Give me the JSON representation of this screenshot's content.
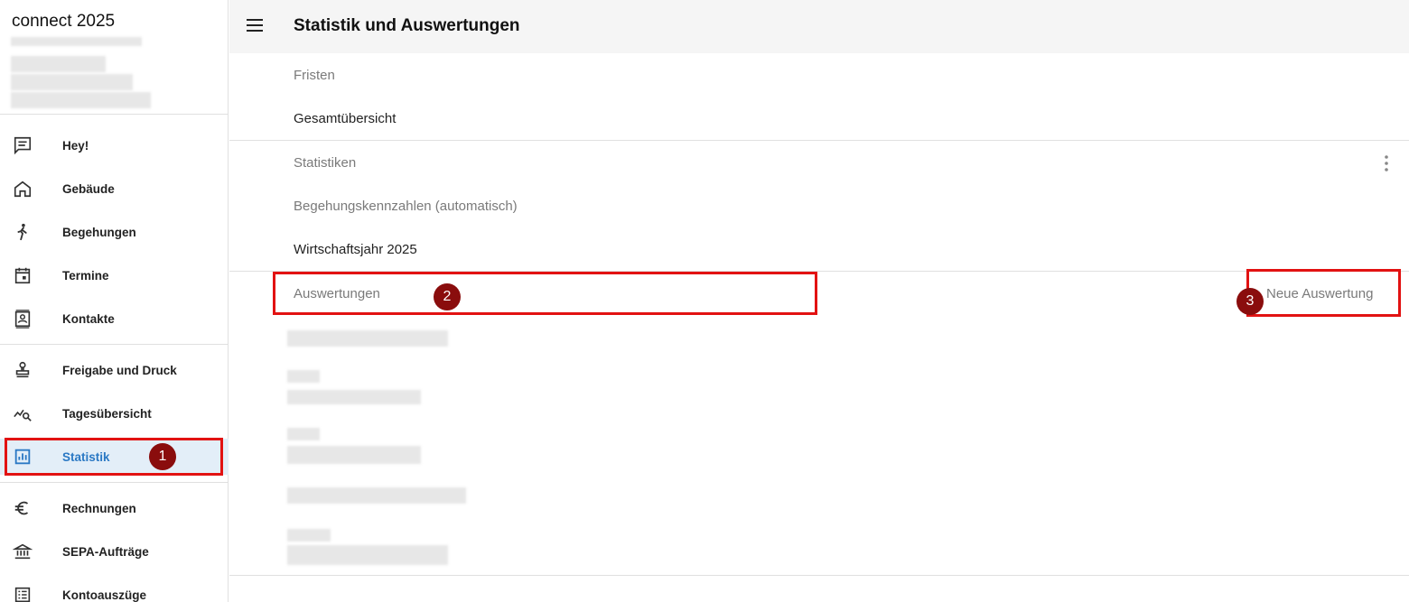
{
  "app": {
    "name": "connect 2025"
  },
  "header": {
    "title": "Statistik und Auswertungen"
  },
  "sidebar": {
    "items": [
      {
        "label": "Hey!",
        "icon": "chat-icon"
      },
      {
        "label": "Gebäude",
        "icon": "home-icon"
      },
      {
        "label": "Begehungen",
        "icon": "walk-icon"
      },
      {
        "label": "Termine",
        "icon": "calendar-icon"
      },
      {
        "label": "Kontakte",
        "icon": "contact-card-icon"
      },
      {
        "label": "Freigabe und Druck",
        "icon": "stamp-icon"
      },
      {
        "label": "Tagesübersicht",
        "icon": "chart-search-icon"
      },
      {
        "label": "Statistik",
        "icon": "bar-chart-icon",
        "active": true
      },
      {
        "label": "Rechnungen",
        "icon": "euro-icon"
      },
      {
        "label": "SEPA-Aufträge",
        "icon": "bank-icon"
      },
      {
        "label": "Kontoauszüge",
        "icon": "list-icon"
      }
    ]
  },
  "main": {
    "fristen": {
      "header": "Fristen",
      "item": "Gesamtübersicht"
    },
    "statistiken": {
      "header": "Statistiken",
      "items": [
        "Begehungskennzahlen (automatisch)",
        "Wirtschaftsjahr 2025"
      ]
    },
    "auswertungen": {
      "header": "Auswertungen",
      "action": "Neue Auswertung"
    }
  },
  "annotations": {
    "badges": [
      "1",
      "2",
      "3"
    ],
    "color": "#e21212",
    "badge_color": "#8a0d0d"
  },
  "colors": {
    "accent": "#2a78c4",
    "active_bg": "#e3eef8",
    "header_bg": "#f5f5f5"
  }
}
